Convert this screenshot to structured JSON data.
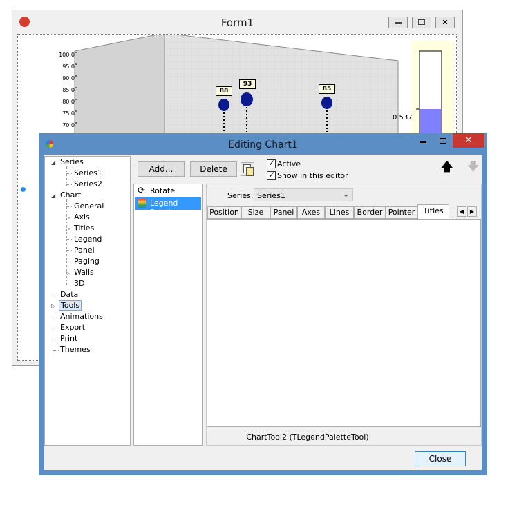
{
  "form1": {
    "title": "Form1",
    "y_axis_ticks": [
      "100.0",
      "95.0",
      "90.0",
      "85.0",
      "80.0",
      "75.0",
      "70.0"
    ],
    "point_labels": [
      "88",
      "93",
      "85"
    ],
    "legend_palette_value": "0.537"
  },
  "editor": {
    "title": "Editing Chart1",
    "tree": {
      "series": "Series",
      "series1": "Series1",
      "series2": "Series2",
      "chart": "Chart",
      "general": "General",
      "axis": "Axis",
      "titles": "Titles",
      "legend": "Legend",
      "panel": "Panel",
      "paging": "Paging",
      "walls": "Walls",
      "three_d": "3D",
      "data": "Data",
      "tools": "Tools",
      "animations": "Animations",
      "export": "Export",
      "print": "Print",
      "themes": "Themes"
    },
    "toolbar": {
      "add_label": "Add...",
      "delete_label": "Delete",
      "active_label": "Active",
      "show_label": "Show in this editor"
    },
    "tools_list": [
      "Rotate",
      "Legend Palette"
    ],
    "series_label": "Series:",
    "series_value": "Series1",
    "tabs": [
      "Position",
      "Size",
      "Panel",
      "Axes",
      "Lines",
      "Border",
      "Pointer",
      "Titles"
    ],
    "status": "ChartTool2 (TLegendPaletteTool)",
    "close_label": "Close"
  },
  "colors": {
    "title_bar": "#5b8ec4",
    "close_red": "#c7392f",
    "point_fill": "#0b1a8f",
    "palette_fill": "#8080ff",
    "palette_bg": "#ffffe0",
    "selected": "#3399ff"
  }
}
